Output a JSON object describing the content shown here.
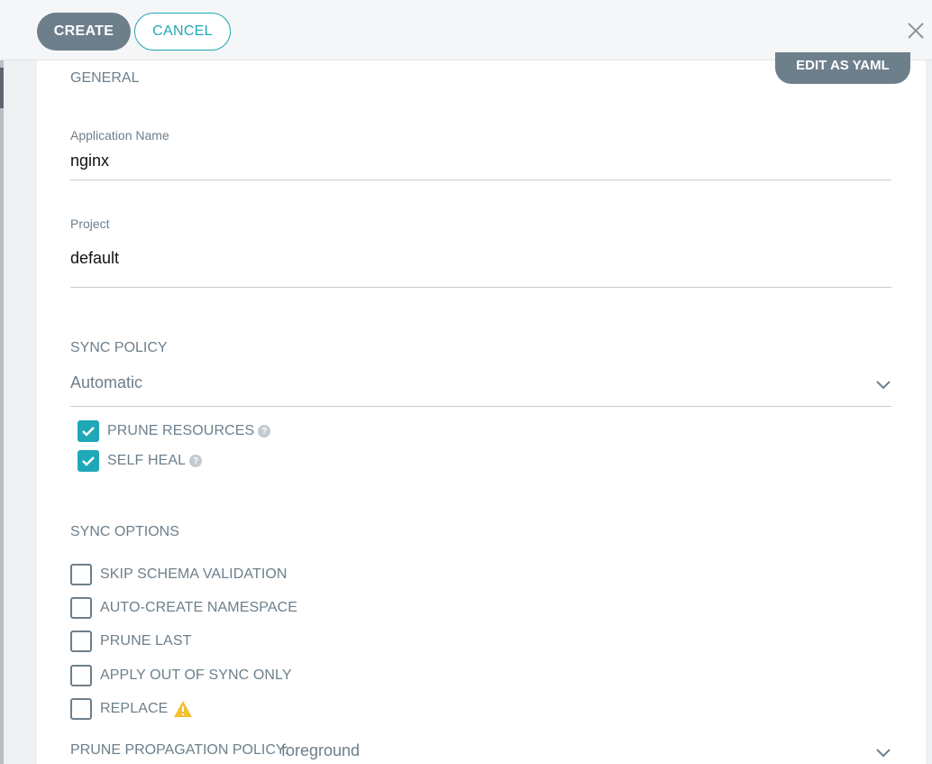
{
  "header": {
    "create_label": "CREATE",
    "cancel_label": "CANCEL"
  },
  "toolbar": {
    "edit_yaml_label": "EDIT AS YAML"
  },
  "general": {
    "title": "GENERAL",
    "app_name_label": "Application Name",
    "app_name_value": "nginx",
    "project_label": "Project",
    "project_value": "default"
  },
  "sync_policy": {
    "title": "SYNC POLICY",
    "selected": "Automatic",
    "options": [
      {
        "label": "PRUNE RESOURCES",
        "checked": true
      },
      {
        "label": "SELF HEAL",
        "checked": true
      }
    ]
  },
  "sync_options": {
    "title": "SYNC OPTIONS",
    "items": [
      {
        "label": "SKIP SCHEMA VALIDATION",
        "checked": false
      },
      {
        "label": "AUTO-CREATE NAMESPACE",
        "checked": false
      },
      {
        "label": "PRUNE LAST",
        "checked": false
      },
      {
        "label": "APPLY OUT OF SYNC ONLY",
        "checked": false
      },
      {
        "label": "REPLACE",
        "checked": false,
        "icon": "warning-icon"
      }
    ]
  },
  "prune_policy": {
    "label": "PRUNE PROPAGATION POLICY:",
    "value": "foreground"
  },
  "colors": {
    "accent": "#20a8b8",
    "button_gray": "#6d7f8b",
    "warning": "#f4c030"
  }
}
